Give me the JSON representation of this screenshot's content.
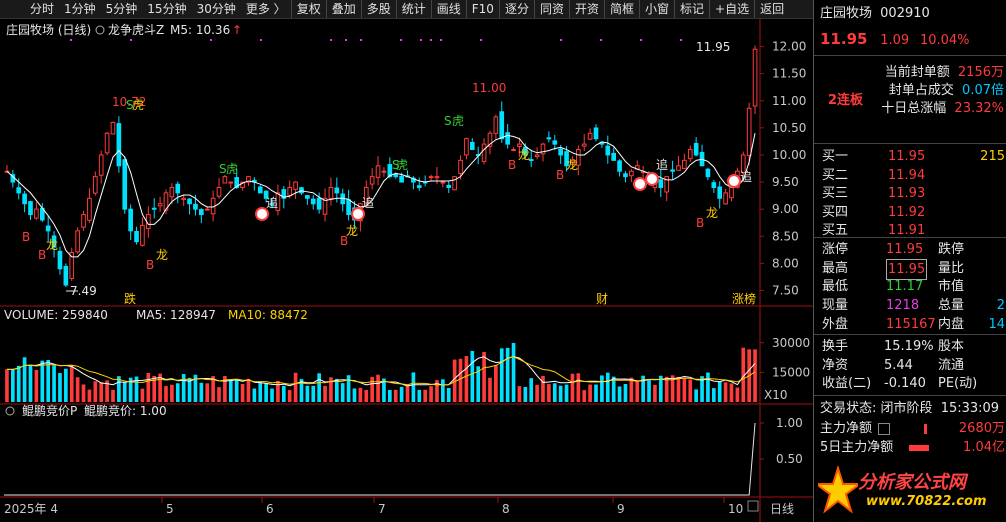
{
  "toolbar": {
    "items": [
      "分时",
      "1分钟",
      "5分钟",
      "15分钟",
      "30分钟",
      "更多 〉",
      "复权",
      "叠加",
      "多股",
      "统计",
      "画线",
      "F10",
      "逐分",
      "同资",
      "开资",
      "简框",
      "小窗",
      "标记",
      "+自选",
      "返回"
    ]
  },
  "main": {
    "title": "庄园牧场 (日线)",
    "indicator_name": "龙争虎斗Z",
    "ma5_label": "M5: 10.36",
    "up_arrow": "↑",
    "yaxis": [
      "12.00",
      "11.50",
      "11.00",
      "10.50",
      "10.00",
      "9.50",
      "9.00",
      "8.50",
      "8.00",
      "7.50"
    ],
    "high_mark": "11.00",
    "peak_mark": "11.95",
    "low_mark": "7.49",
    "left_peak": "10.72",
    "tags": {
      "dragon": "龙",
      "tiger": "虎",
      "buy": "B",
      "chase": "追",
      "s": "S",
      "drop": "跌",
      "fin": "财",
      "limit": "涨榜"
    }
  },
  "volume": {
    "label": "VOLUME: 259840",
    "ma5": "MA5: 128947",
    "ma10": "MA10: 88472",
    "yaxis": [
      "30000",
      "15000",
      "X10"
    ]
  },
  "sub": {
    "label1": "鲲鹏竞价P",
    "label2": "鲲鹏竞价: 1.00",
    "yaxis": [
      "1.00",
      "0.50"
    ]
  },
  "xaxis": {
    "year": "2025年 4",
    "months": [
      "5",
      "6",
      "7",
      "8",
      "9",
      "10"
    ],
    "right": "日线"
  },
  "panel": {
    "name": "庄园牧场",
    "code": "002910",
    "price": "11.95",
    "change": "1.09",
    "pct": "10.04%",
    "seal_label": "当前封单额",
    "seal_value": "2156万",
    "seal_ratio_label": "封单占成交",
    "seal_ratio_value": "0.07倍",
    "ten_day_label": "十日总涨幅",
    "ten_day_value": "23.32%",
    "streak": "2连板",
    "bids": [
      {
        "label": "买一",
        "price": "11.95",
        "vol": "215"
      },
      {
        "label": "买二",
        "price": "11.94",
        "vol": ""
      },
      {
        "label": "买三",
        "price": "11.93",
        "vol": ""
      },
      {
        "label": "买四",
        "price": "11.92",
        "vol": ""
      },
      {
        "label": "买五",
        "price": "11.91",
        "vol": ""
      }
    ],
    "stats": [
      {
        "l1": "涨停",
        "v1": "11.95",
        "l2": "跌停",
        "v2": ""
      },
      {
        "l1": "最高",
        "v1": "11.95",
        "l2": "量比",
        "v2": ""
      },
      {
        "l1": "最低",
        "v1": "11.17",
        "l2": "市值",
        "v2": ""
      },
      {
        "l1": "现量",
        "v1": "1218",
        "l2": "总量",
        "v2": "2"
      },
      {
        "l1": "外盘",
        "v1": "115167",
        "l2": "内盘",
        "v2": "14"
      }
    ],
    "stats2": [
      {
        "l1": "换手",
        "v1": "15.19%",
        "l2": "股本"
      },
      {
        "l1": "净资",
        "v1": "5.44",
        "l2": "流通"
      },
      {
        "l1": "收益(二)",
        "v1": "-0.140",
        "l2": "PE(动)"
      }
    ],
    "trade_status_label": "交易状态:",
    "trade_status": "闭市阶段",
    "time": "15:33:09",
    "main_net_label": "主力净额",
    "main_net": "2680万",
    "five_day_label": "5日主力净额",
    "five_day": "1.04亿",
    "logo_text": "分析家公式网",
    "logo_url": "www.70822.com"
  },
  "watermark": "分析家公式网www.70822.com",
  "colors": {
    "up": "#ff3b3b",
    "down": "#00e0ff",
    "ma": "#ffffff",
    "vol_ma5": "#ffffff",
    "vol_ma10": "#ffd000",
    "bg": "#000000"
  }
}
